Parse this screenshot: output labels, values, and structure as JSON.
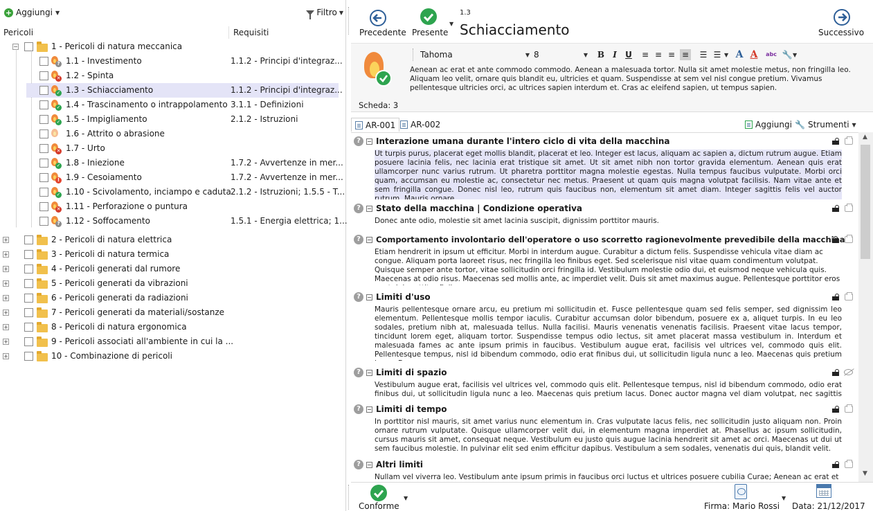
{
  "left_toolbar": {
    "add_label": "Aggiungi",
    "filter_label": "Filtro"
  },
  "columns": {
    "hazards": "Pericoli",
    "requirements": "Requisiti"
  },
  "tree": {
    "group1": {
      "label": "1 - Pericoli di natura meccanica"
    },
    "items": [
      {
        "label": "1.1 - Investimento",
        "req": "1.1.2 - Principi d'integraz...",
        "status": "question"
      },
      {
        "label": "1.2 - Spinta",
        "req": "",
        "status": "x"
      },
      {
        "label": "1.3 - Schiacciamento",
        "req": "1.1.2 - Principi d'integraz...",
        "status": "ok"
      },
      {
        "label": "1.4 - Trascinamento o intrappolamento",
        "req": "3.1.1 - Definizioni",
        "status": "ok"
      },
      {
        "label": "1.5 - Impigliamento",
        "req": "2.1.2 - Istruzioni",
        "status": "ok"
      },
      {
        "label": "1.6 - Attrito o abrasione",
        "req": "",
        "status": "none"
      },
      {
        "label": "1.7 - Urto",
        "req": "",
        "status": "x"
      },
      {
        "label": "1.8 - Iniezione",
        "req": "1.7.2 - Avvertenze in mer...",
        "status": "ok"
      },
      {
        "label": "1.9 - Cesoiamento",
        "req": "1.7.2 - Avvertenze in mer...",
        "status": "red"
      },
      {
        "label": "1.10 - Scivolamento, inciampo e caduta",
        "req": "2.1.2 - Istruzioni; 1.5.5 - T...",
        "status": "ok"
      },
      {
        "label": "1.11 - Perforazione o puntura",
        "req": "",
        "status": "x"
      },
      {
        "label": "1.12 - Soffocamento",
        "req": "1.5.1 - Energia elettrica; 1...",
        "status": "question"
      }
    ],
    "groups": [
      {
        "label": "2 - Pericoli di natura elettrica"
      },
      {
        "label": "3 - Pericoli di natura termica"
      },
      {
        "label": "4 - Pericoli generati dal rumore"
      },
      {
        "label": "5 - Pericoli generati da vibrazioni"
      },
      {
        "label": "6 - Pericoli generati da radiazioni"
      },
      {
        "label": "7 - Pericoli generati da materiali/sostanze"
      },
      {
        "label": "8 - Pericoli di natura ergonomica"
      },
      {
        "label": "9 - Pericoli associati all'ambiente in cui la ..."
      },
      {
        "label": "10 - Combinazione di pericoli"
      }
    ]
  },
  "nav": {
    "prev": "Precedente",
    "present": "Presente",
    "next": "Successivo",
    "code": "1.3",
    "title": "Schiacciamento"
  },
  "format": {
    "font": "Tahoma",
    "size": "8"
  },
  "description": "Aenean ac erat et ante commodo commodo. Aenean a malesuada tortor. Nulla sit amet molestie metus, non fringilla leo. Aliquam leo velit, ornare quis blandit eu, ultricies et quam. Suspendisse at sem vel nisl congue pretium. Vivamus pellentesque ultricies orci, ac ultrices sapien interdum et. Cras ac eleifend sapien, ut tempus sapien.",
  "scheda": "Scheda: 3",
  "tabs": {
    "t1": "AR-001",
    "t2": "AR-002",
    "add": "Aggiungi",
    "tools": "Strumenti"
  },
  "sections": [
    {
      "title": "Interazione umana durante l'intero ciclo di vita della macchina",
      "body": "Ut turpis purus, placerat eget mollis blandit, placerat et leo. Integer est lacus, aliquam ac sapien a, dictum rutrum augue. Etiam posuere lacinia felis, nec lacinia erat tristique sit amet. Ut sit amet nibh non tortor gravida elementum. Aenean quis erat ullamcorper nunc varius rutrum. Ut pharetra porttitor magna molestie egestas. Nulla tempus faucibus vulputate. Morbi orci quam, accumsan eu molestie ac, consectetur nec metus. Praesent ut quam quis magna volutpat facilisis. Nam vitae ante et sem fringilla congue. Donec nisl leo, rutrum quis faucibus non, elementum sit amet diam. Integer sagittis felis vel auctor rutrum. Mauris ornare"
    },
    {
      "title": "Stato della macchina | Condizione operativa",
      "body": "Donec ante odio, molestie sit amet lacinia suscipit, dignissim porttitor mauris."
    },
    {
      "title": "Comportamento involontario dell'operatore o uso scorretto ragionevolmente prevedibile della macchina",
      "body": "Etiam hendrerit in ipsum ut efficitur. Morbi in interdum augue. Curabitur a dictum felis. Suspendisse vehicula vitae diam ac congue. Aliquam porta laoreet risus, nec fringilla leo finibus eget. Sed scelerisque nisl vitae quam condimentum volutpat. Quisque semper ante tortor, vitae sollicitudin orci fringilla id. Vestibulum molestie odio dui, et euismod neque vehicula quis. Maecenas at odio risus. Maecenas sed mollis ante, ac imperdiet velit. Duis sit amet maximus augue. Pellentesque porttitor eros eget dui porttitor finibus."
    },
    {
      "title": "Limiti d'uso",
      "body": "Mauris pellentesque ornare arcu, eu pretium mi sollicitudin et. Fusce pellentesque quam sed felis semper, sed dignissim leo elementum. Pellentesque mollis tempor iaculis. Curabitur accumsan dolor bibendum, posuere ex a, aliquet turpis. In eu leo sodales, pretium nibh at, malesuada tellus. Nulla facilisi. Mauris venenatis venenatis facilisis. Praesent vitae lacus tempor, tincidunt lorem eget, aliquam tortor. Suspendisse tempus odio lectus, sit amet placerat massa vestibulum in. Interdum et malesuada fames ac ante ipsum primis in faucibus. Vestibulum augue erat, facilisis vel ultrices vel, commodo quis elit. Pellentesque tempus, nisl id bibendum commodo, odio erat finibus dui, ut sollicitudin ligula nunc a leo. Maecenas quis pretium lacus. Donec"
    },
    {
      "title": "Limiti di spazio",
      "body": "Vestibulum augue erat, facilisis vel ultrices vel, commodo quis elit. Pellentesque tempus, nisl id bibendum commodo, odio erat finibus dui, ut sollicitudin ligula nunc a leo. Maecenas quis pretium lacus. Donec auctor magna vel diam volutpat, nec sagittis tortor"
    },
    {
      "title": "Limiti di tempo",
      "body": "In porttitor nisl mauris, sit amet varius nunc elementum in. Cras vulputate lacus felis, nec sollicitudin justo aliquam non. Proin ornare rutrum vulputate. Quisque ullamcorper velit dui, in elementum magna imperdiet at. Phasellus ac ipsum sollicitudin, cursus mauris sit amet, consequat neque. Vestibulum eu justo quis augue lacinia hendrerit sit amet ac orci. Maecenas ut dui ut sem faucibus molestie. In pulvinar elit sed enim efficitur dapibus. Vestibulum a sem sodales, venenatis dui quis, blandit velit."
    },
    {
      "title": "Altri limiti",
      "body": "Nullam vel viverra leo. Vestibulum ante ipsum primis in faucibus orci luctus et ultrices posuere cubilia Curae; Aenean ac erat et"
    }
  ],
  "bottom": {
    "conforme": "Conforme",
    "firma": "Firma: Mario Rossi",
    "data": "Data: 21/12/2017"
  },
  "colors": {
    "accent_green": "#2ea44f",
    "nav_blue": "#3a6ea8",
    "selection": "#e4e4f7"
  }
}
